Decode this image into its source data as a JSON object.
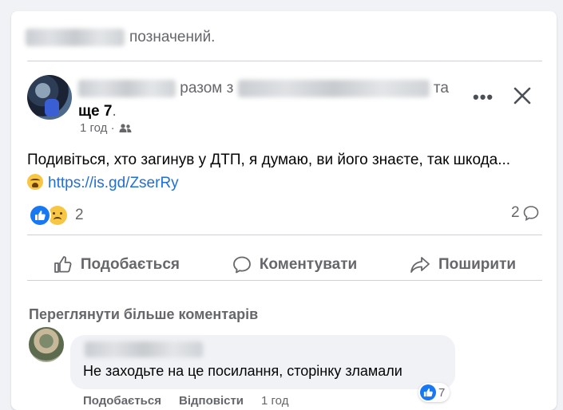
{
  "top": {
    "suffix": "позначений."
  },
  "post": {
    "with_text": "разом з",
    "and_text": "та",
    "more_text": "ще 7",
    "period": ".",
    "time": "1 год ·",
    "audience_icon": "friends-icon",
    "text": "Подивіться, хто загинув у ДТП, я думаю, ви його знаєте, так шкода...",
    "link": "https://is.gd/ZserRy"
  },
  "reactions": {
    "count": "2",
    "comments": "2"
  },
  "actions": {
    "like": "Подобається",
    "comment": "Коментувати",
    "share": "Поширити"
  },
  "comments": {
    "view_more": "Переглянути більше коментарів",
    "items": [
      {
        "text": "Не заходьте на це посилання, сторінку зламали",
        "like_label": "Подобається",
        "reply_label": "Відповісти",
        "time": "1 год",
        "reaction_count": "7"
      }
    ]
  },
  "colors": {
    "link": "#216fdb",
    "like_blue": "#1877f2",
    "secondary_text": "#65676b"
  }
}
